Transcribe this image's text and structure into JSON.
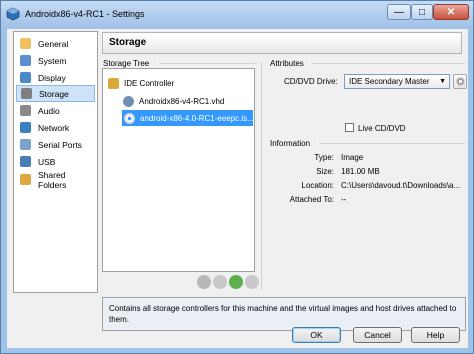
{
  "window": {
    "title": "Androidx86-v4-RC1 - Settings",
    "min_glyph": "—",
    "max_glyph": "□",
    "close_glyph": "✕"
  },
  "nav": {
    "items": [
      {
        "label": "General",
        "icon": "general-icon",
        "color": "#f0c060"
      },
      {
        "label": "System",
        "icon": "system-icon",
        "color": "#5a8fd1"
      },
      {
        "label": "Display",
        "icon": "display-icon",
        "color": "#4c89c8"
      },
      {
        "label": "Storage",
        "icon": "storage-icon",
        "color": "#7f7f7f"
      },
      {
        "label": "Audio",
        "icon": "audio-icon",
        "color": "#8a8a8a"
      },
      {
        "label": "Network",
        "icon": "network-icon",
        "color": "#3d7fc1"
      },
      {
        "label": "Serial Ports",
        "icon": "serial-ports-icon",
        "color": "#7da2c8"
      },
      {
        "label": "USB",
        "icon": "usb-icon",
        "color": "#4a7cb8"
      },
      {
        "label": "Shared Folders",
        "icon": "shared-folders-icon",
        "color": "#e0a640"
      }
    ],
    "selected": "Storage"
  },
  "header": {
    "title": "Storage"
  },
  "storage_tree": {
    "label": "Storage Tree",
    "controller": "IDE Controller",
    "items": [
      {
        "label": "Androidx86-v4-RC1.vhd",
        "icon": "hard-disk-icon"
      },
      {
        "label": "android-x86-4.0-RC1-eeepc.is...",
        "icon": "optical-disk-icon"
      }
    ]
  },
  "attributes": {
    "label": "Attributes",
    "drive_label": "CD/DVD Drive:",
    "drive_value": "IDE Secondary Master",
    "dropdown_glyph": "▼",
    "live_cd_label": "Live CD/DVD",
    "live_cd_checked": false
  },
  "information": {
    "label": "Information",
    "rows": [
      {
        "key": "Type:",
        "value": "Image"
      },
      {
        "key": "Size:",
        "value": "181.00 MB"
      },
      {
        "key": "Location:",
        "value": "C:\\Users\\davoud.t\\Downloads\\a..."
      },
      {
        "key": "Attached To:",
        "value": "--"
      }
    ]
  },
  "description": "Contains all storage controllers for this machine and the virtual images and host drives attached to them.",
  "buttons": {
    "ok": "OK",
    "cancel": "Cancel",
    "help": "Help"
  },
  "colors": {
    "selection": "#3399ff",
    "title_bar": "#9fc2e6",
    "close_button": "#c8513c"
  }
}
